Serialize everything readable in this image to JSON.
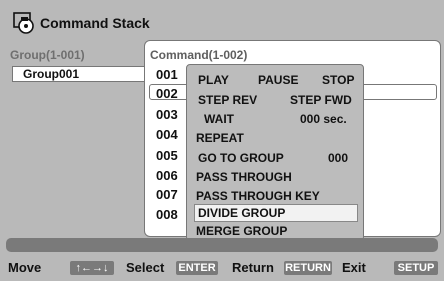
{
  "title": "Command Stack",
  "left": {
    "header": "Group(1-001)",
    "selected_group": "Group001"
  },
  "right": {
    "header": "Command(1-002)",
    "rows": [
      "001",
      "002",
      "003",
      "004",
      "005",
      "006",
      "007",
      "008"
    ],
    "selected_row": "002"
  },
  "menu": {
    "play": "PLAY",
    "pause": "PAUSE",
    "stop": "STOP",
    "step_rev": "STEP REV",
    "step_fwd": "STEP FWD",
    "wait": "WAIT",
    "wait_value": "000 sec.",
    "repeat": "REPEAT",
    "goto": "GO TO GROUP",
    "goto_value": "000",
    "pass_through": "PASS THROUGH",
    "pass_through_key": "PASS THROUGH KEY",
    "divide": "DIVIDE GROUP",
    "merge": "MERGE GROUP",
    "highlighted": "DIVIDE GROUP"
  },
  "footer": {
    "move_label": "Move",
    "move_key": "↑←→↓",
    "select_label": "Select",
    "select_key": "ENTER",
    "return_label": "Return",
    "return_key": "RETURN",
    "exit_label": "Exit",
    "exit_key": "SETUP"
  },
  "colors": {
    "background": "#b9b9b9",
    "panel": "#ffffff",
    "menu": "#bcbcbc",
    "key_box": "#7a7a7a",
    "highlight": "#f2f2f2"
  }
}
